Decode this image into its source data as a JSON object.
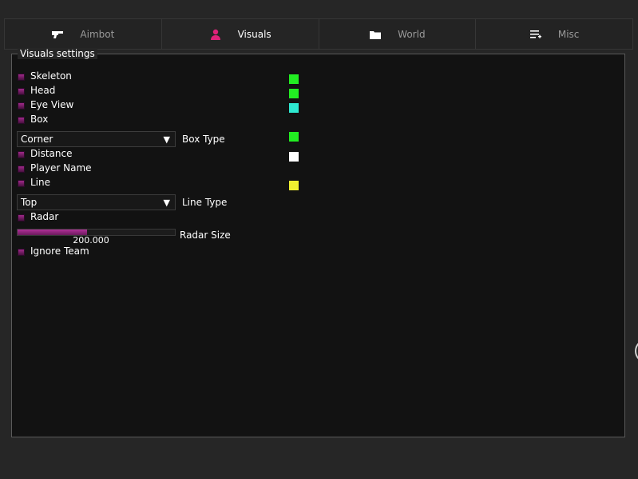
{
  "tabs": [
    {
      "label": "Aimbot",
      "icon": "gun-icon",
      "active": false
    },
    {
      "label": "Visuals",
      "icon": "person-icon",
      "active": true
    },
    {
      "label": "World",
      "icon": "folder-icon",
      "active": false
    },
    {
      "label": "Misc",
      "icon": "list-add-icon",
      "active": false
    }
  ],
  "panel": {
    "title": "Visuals settings"
  },
  "options": {
    "skeleton": "Skeleton",
    "head": "Head",
    "eye_view": "Eye View",
    "box": "Box",
    "distance": "Distance",
    "player_name": "Player Name",
    "line": "Line",
    "radar": "Radar",
    "ignore_team": "Ignore Team"
  },
  "box_type": {
    "label": "Box Type",
    "selected": "Corner"
  },
  "line_type": {
    "label": "Line Type",
    "selected": "Top"
  },
  "radar_size": {
    "label": "Radar Size",
    "value_text": "200.000",
    "fill_fraction": 0.44
  },
  "colors": {
    "accent": "#a02a8a",
    "tab_icon_active": "#e0227a",
    "skeleton": "#22ee22",
    "head": "#22ee22",
    "eye_view": "#2ee8d0",
    "box": "#22ee22",
    "distance": "#ffffff",
    "line": "#f0f030"
  }
}
